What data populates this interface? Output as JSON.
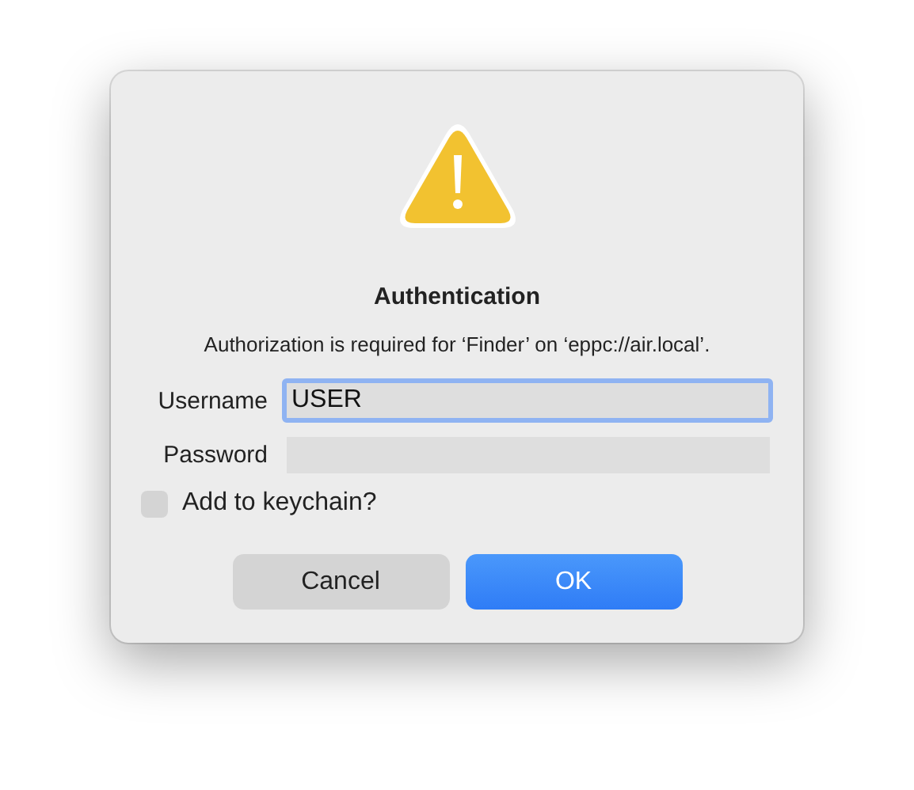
{
  "dialog": {
    "title": "Authentication",
    "message": "Authorization is required for ‘Finder’ on ‘eppc://air.local’.",
    "fields": [
      {
        "label": "Username",
        "value": "USER",
        "focused": true
      },
      {
        "label": "Password",
        "focused": false
      }
    ],
    "checkbox": {
      "label": "Add to keychain?",
      "checked": false
    },
    "buttons": [
      {
        "label": "Cancel",
        "kind": "secondary"
      },
      {
        "label": "OK",
        "kind": "default"
      }
    ]
  }
}
